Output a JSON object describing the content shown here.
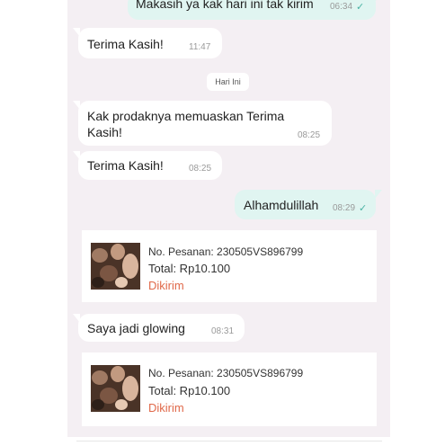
{
  "messages": {
    "m1": {
      "text": "Makasih ya kak hari ini tak kirim",
      "time": "06:34",
      "check": "✓"
    },
    "m2": {
      "text": "Terima Kasih!",
      "time": "11:47"
    },
    "day": "Hari Ini",
    "m3": {
      "text": "Kak prodaknya memuaskan Terima Kasih!",
      "time": "08:25"
    },
    "m4": {
      "text": "Terima Kasih!",
      "time": "08:25"
    },
    "m5": {
      "text": "Alhamdulillah",
      "time": "08:29",
      "check": "✓"
    },
    "m6": {
      "text": "Saya jadi glowing",
      "time": "08:31"
    }
  },
  "orders": [
    {
      "order_no": "No. Pesanan: 230505VS896799",
      "total": "Total: Rp10.100",
      "status": "Dikirim"
    },
    {
      "order_no": "No. Pesanan: 230505VS896799",
      "total": "Total: Rp10.100",
      "status": "Dikirim"
    }
  ],
  "colors": {
    "chat_bg": "#f4eff3",
    "outgoing_bubble": "#e0f5f1",
    "incoming_bubble": "#ffffff",
    "status_accent": "#e0694a",
    "read_check": "#4ab3a4"
  },
  "icons": [
    "read-check-icon",
    "product-thumbnail"
  ]
}
